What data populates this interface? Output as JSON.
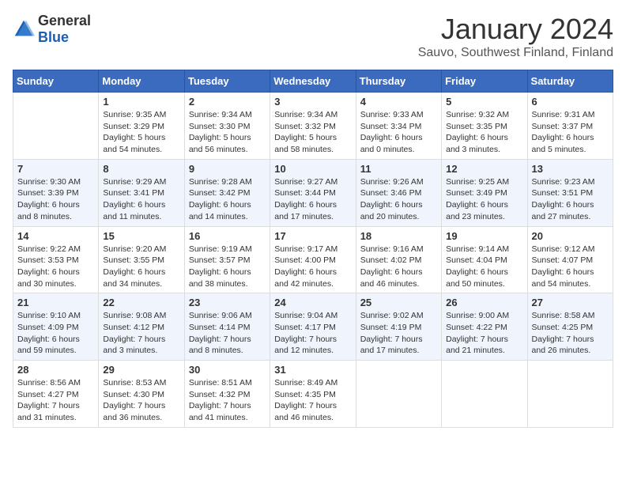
{
  "header": {
    "logo_general": "General",
    "logo_blue": "Blue",
    "month_title": "January 2024",
    "location": "Sauvo, Southwest Finland, Finland"
  },
  "days_of_week": [
    "Sunday",
    "Monday",
    "Tuesday",
    "Wednesday",
    "Thursday",
    "Friday",
    "Saturday"
  ],
  "weeks": [
    [
      {
        "day": "",
        "info": ""
      },
      {
        "day": "1",
        "info": "Sunrise: 9:35 AM\nSunset: 3:29 PM\nDaylight: 5 hours\nand 54 minutes."
      },
      {
        "day": "2",
        "info": "Sunrise: 9:34 AM\nSunset: 3:30 PM\nDaylight: 5 hours\nand 56 minutes."
      },
      {
        "day": "3",
        "info": "Sunrise: 9:34 AM\nSunset: 3:32 PM\nDaylight: 5 hours\nand 58 minutes."
      },
      {
        "day": "4",
        "info": "Sunrise: 9:33 AM\nSunset: 3:34 PM\nDaylight: 6 hours\nand 0 minutes."
      },
      {
        "day": "5",
        "info": "Sunrise: 9:32 AM\nSunset: 3:35 PM\nDaylight: 6 hours\nand 3 minutes."
      },
      {
        "day": "6",
        "info": "Sunrise: 9:31 AM\nSunset: 3:37 PM\nDaylight: 6 hours\nand 5 minutes."
      }
    ],
    [
      {
        "day": "7",
        "info": "Sunrise: 9:30 AM\nSunset: 3:39 PM\nDaylight: 6 hours\nand 8 minutes."
      },
      {
        "day": "8",
        "info": "Sunrise: 9:29 AM\nSunset: 3:41 PM\nDaylight: 6 hours\nand 11 minutes."
      },
      {
        "day": "9",
        "info": "Sunrise: 9:28 AM\nSunset: 3:42 PM\nDaylight: 6 hours\nand 14 minutes."
      },
      {
        "day": "10",
        "info": "Sunrise: 9:27 AM\nSunset: 3:44 PM\nDaylight: 6 hours\nand 17 minutes."
      },
      {
        "day": "11",
        "info": "Sunrise: 9:26 AM\nSunset: 3:46 PM\nDaylight: 6 hours\nand 20 minutes."
      },
      {
        "day": "12",
        "info": "Sunrise: 9:25 AM\nSunset: 3:49 PM\nDaylight: 6 hours\nand 23 minutes."
      },
      {
        "day": "13",
        "info": "Sunrise: 9:23 AM\nSunset: 3:51 PM\nDaylight: 6 hours\nand 27 minutes."
      }
    ],
    [
      {
        "day": "14",
        "info": "Sunrise: 9:22 AM\nSunset: 3:53 PM\nDaylight: 6 hours\nand 30 minutes."
      },
      {
        "day": "15",
        "info": "Sunrise: 9:20 AM\nSunset: 3:55 PM\nDaylight: 6 hours\nand 34 minutes."
      },
      {
        "day": "16",
        "info": "Sunrise: 9:19 AM\nSunset: 3:57 PM\nDaylight: 6 hours\nand 38 minutes."
      },
      {
        "day": "17",
        "info": "Sunrise: 9:17 AM\nSunset: 4:00 PM\nDaylight: 6 hours\nand 42 minutes."
      },
      {
        "day": "18",
        "info": "Sunrise: 9:16 AM\nSunset: 4:02 PM\nDaylight: 6 hours\nand 46 minutes."
      },
      {
        "day": "19",
        "info": "Sunrise: 9:14 AM\nSunset: 4:04 PM\nDaylight: 6 hours\nand 50 minutes."
      },
      {
        "day": "20",
        "info": "Sunrise: 9:12 AM\nSunset: 4:07 PM\nDaylight: 6 hours\nand 54 minutes."
      }
    ],
    [
      {
        "day": "21",
        "info": "Sunrise: 9:10 AM\nSunset: 4:09 PM\nDaylight: 6 hours\nand 59 minutes."
      },
      {
        "day": "22",
        "info": "Sunrise: 9:08 AM\nSunset: 4:12 PM\nDaylight: 7 hours\nand 3 minutes."
      },
      {
        "day": "23",
        "info": "Sunrise: 9:06 AM\nSunset: 4:14 PM\nDaylight: 7 hours\nand 8 minutes."
      },
      {
        "day": "24",
        "info": "Sunrise: 9:04 AM\nSunset: 4:17 PM\nDaylight: 7 hours\nand 12 minutes."
      },
      {
        "day": "25",
        "info": "Sunrise: 9:02 AM\nSunset: 4:19 PM\nDaylight: 7 hours\nand 17 minutes."
      },
      {
        "day": "26",
        "info": "Sunrise: 9:00 AM\nSunset: 4:22 PM\nDaylight: 7 hours\nand 21 minutes."
      },
      {
        "day": "27",
        "info": "Sunrise: 8:58 AM\nSunset: 4:25 PM\nDaylight: 7 hours\nand 26 minutes."
      }
    ],
    [
      {
        "day": "28",
        "info": "Sunrise: 8:56 AM\nSunset: 4:27 PM\nDaylight: 7 hours\nand 31 minutes."
      },
      {
        "day": "29",
        "info": "Sunrise: 8:53 AM\nSunset: 4:30 PM\nDaylight: 7 hours\nand 36 minutes."
      },
      {
        "day": "30",
        "info": "Sunrise: 8:51 AM\nSunset: 4:32 PM\nDaylight: 7 hours\nand 41 minutes."
      },
      {
        "day": "31",
        "info": "Sunrise: 8:49 AM\nSunset: 4:35 PM\nDaylight: 7 hours\nand 46 minutes."
      },
      {
        "day": "",
        "info": ""
      },
      {
        "day": "",
        "info": ""
      },
      {
        "day": "",
        "info": ""
      }
    ]
  ]
}
